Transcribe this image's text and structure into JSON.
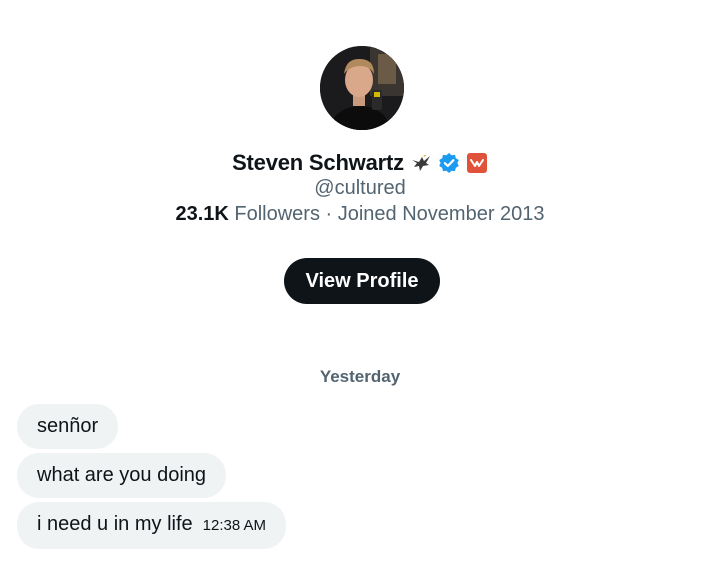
{
  "profile": {
    "name": "Steven Schwartz",
    "handle": "@cultured",
    "followers_count": "23.1K",
    "followers_label": " Followers",
    "joined": " · Joined November 2013",
    "view_profile_label": "View Profile",
    "badges": [
      "eagle-icon",
      "verified-check-icon",
      "affiliate-badge-icon"
    ],
    "verified_color": "#1d9bf0",
    "affiliate_color": "#e0533a"
  },
  "conversation": {
    "date_separator": "Yesterday",
    "messages": [
      {
        "text": "senñor",
        "time": ""
      },
      {
        "text": "what are you doing",
        "time": ""
      },
      {
        "text": "i need u in my life",
        "time": "12:38 AM"
      }
    ]
  }
}
